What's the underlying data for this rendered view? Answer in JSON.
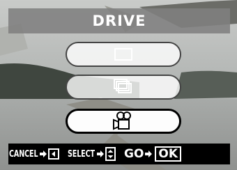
{
  "screen": {
    "title": "DRIVE"
  },
  "options": [
    {
      "id": "single",
      "icon": "single-frame-icon",
      "selected": false
    },
    {
      "id": "sequential",
      "icon": "sequential-frames-icon",
      "selected": false
    },
    {
      "id": "movie",
      "icon": "movie-camera-icon",
      "selected": true
    }
  ],
  "controls": {
    "cancel_label": "CANCEL",
    "select_label": "SELECT",
    "go_label": "GO",
    "ok_label": "OK"
  },
  "colors": {
    "title_bar": "#808080",
    "selected_border": "#000000",
    "hint_bar": "#000000"
  }
}
